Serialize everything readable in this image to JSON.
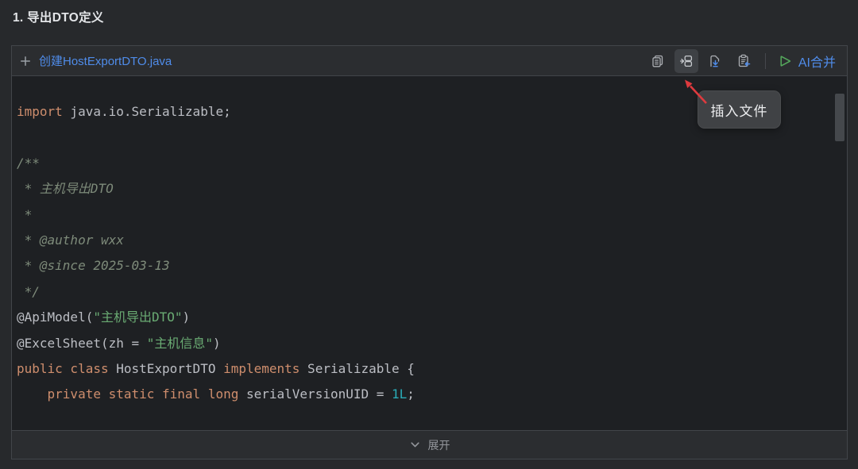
{
  "colors": {
    "page_bg": "#27292c",
    "code_bg": "#1e2023",
    "accent_blue": "#4f8cea",
    "keyword": "#cf8e6d",
    "plain": "#bcbec4",
    "comment": "#7e8b7a",
    "string": "#6aab73",
    "number": "#2aacb8",
    "play_green": "#55a95c",
    "arrow_red": "#de3a3e"
  },
  "page": {
    "title": "1. 导出DTO定义"
  },
  "panel": {
    "filename": "创建HostExportDTO.java",
    "toolbar": {
      "icon_names": [
        "copy-icon",
        "insert-file-icon",
        "save-to-file-icon",
        "clipboard-apply-icon"
      ],
      "active_icon": "insert-file-icon",
      "run_label": "AI合并"
    },
    "tooltip": {
      "text": "插入文件"
    },
    "footer": {
      "expand_label": "展开"
    }
  },
  "code": {
    "language": "java",
    "lines": [
      [
        {
          "t": "kw",
          "v": "import"
        },
        {
          "t": "pl",
          "v": " java.io.Serializable;"
        }
      ],
      [],
      [
        {
          "t": "cm",
          "v": "/**"
        }
      ],
      [
        {
          "t": "cm",
          "v": " * 主机导出DTO"
        }
      ],
      [
        {
          "t": "cm",
          "v": " *"
        }
      ],
      [
        {
          "t": "cm",
          "v": " * @author wxx"
        }
      ],
      [
        {
          "t": "cm",
          "v": " * @since 2025-03-13"
        }
      ],
      [
        {
          "t": "cm",
          "v": " */"
        }
      ],
      [
        {
          "t": "pl",
          "v": "@ApiModel("
        },
        {
          "t": "str",
          "v": "\"主机导出DTO\""
        },
        {
          "t": "pl",
          "v": ")"
        }
      ],
      [
        {
          "t": "pl",
          "v": "@ExcelSheet(zh = "
        },
        {
          "t": "str",
          "v": "\"主机信息\""
        },
        {
          "t": "pl",
          "v": ")"
        }
      ],
      [
        {
          "t": "kw",
          "v": "public class"
        },
        {
          "t": "pl",
          "v": " HostExportDTO "
        },
        {
          "t": "kw",
          "v": "implements"
        },
        {
          "t": "pl",
          "v": " Serializable {"
        }
      ],
      [
        {
          "t": "pl",
          "v": "    "
        },
        {
          "t": "kw",
          "v": "private static final long"
        },
        {
          "t": "pl",
          "v": " serialVersionUID = "
        },
        {
          "t": "num",
          "v": "1L"
        },
        {
          "t": "pl",
          "v": ";"
        }
      ]
    ]
  }
}
